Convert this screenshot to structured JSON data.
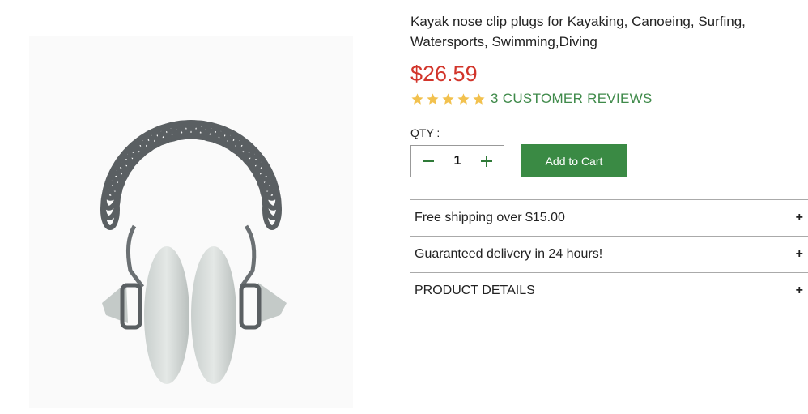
{
  "product": {
    "title": "Kayak nose clip plugs for Kayaking, Canoeing, Surfing, Watersports, Swimming,Diving",
    "price": "$26.59",
    "rating_stars": 5,
    "reviews_label": "3 CUSTOMER REVIEWS",
    "image_icon": "nose-clip-product-image"
  },
  "purchase": {
    "qty_label": "QTY :",
    "qty_value": "1",
    "minus_symbol": "−",
    "plus_symbol": "+",
    "add_to_cart_label": "Add to Cart"
  },
  "accordion": [
    {
      "label": "Free shipping over $15.00",
      "toggle": "+"
    },
    {
      "label": "Guaranteed delivery in 24 hours!",
      "toggle": "+"
    },
    {
      "label": "PRODUCT DETAILS",
      "toggle": "+"
    }
  ],
  "colors": {
    "price": "#d2352b",
    "accent_green": "#3a8a44",
    "reviews_green": "#3f8a4a",
    "star": "#f2c14e"
  }
}
